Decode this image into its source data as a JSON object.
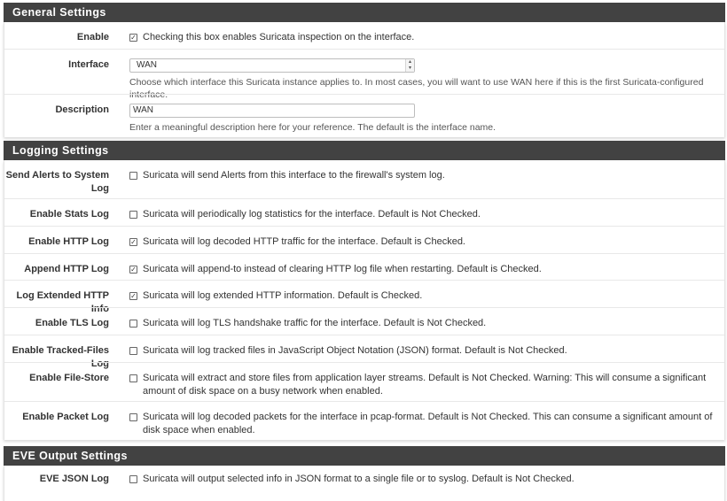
{
  "general": {
    "heading": "General Settings",
    "enable": {
      "label": "Enable",
      "checked": true,
      "text": "Checking this box enables Suricata inspection on the interface."
    },
    "interface": {
      "label": "Interface",
      "value": "WAN",
      "help": "Choose which interface this Suricata instance applies to. In most cases, you will want to use WAN here if this is the first Suricata-configured interface."
    },
    "description": {
      "label": "Description",
      "value": "WAN",
      "help": "Enter a meaningful description here for your reference. The default is the interface name."
    }
  },
  "logging": {
    "heading": "Logging Settings",
    "rows": [
      {
        "label": "Send Alerts to System Log",
        "checked": false,
        "text": "Suricata will send Alerts from this interface to the firewall's system log."
      },
      {
        "label": "Enable Stats Log",
        "checked": false,
        "text": "Suricata will periodically log statistics for the interface. Default is Not Checked."
      },
      {
        "label": "Enable HTTP Log",
        "checked": true,
        "text": "Suricata will log decoded HTTP traffic for the interface. Default is Checked."
      },
      {
        "label": "Append HTTP Log",
        "checked": true,
        "text": "Suricata will append-to instead of clearing HTTP log file when restarting. Default is Checked."
      },
      {
        "label": "Log Extended HTTP Info",
        "checked": true,
        "text": "Suricata will log extended HTTP information. Default is Checked."
      },
      {
        "label": "Enable TLS Log",
        "checked": false,
        "text": "Suricata will log TLS handshake traffic for the interface. Default is Not Checked."
      },
      {
        "label": "Enable Tracked-Files Log",
        "checked": false,
        "text": "Suricata will log tracked files in JavaScript Object Notation (JSON) format. Default is Not Checked."
      },
      {
        "label": "Enable File-Store",
        "checked": false,
        "text": "Suricata will extract and store files from application layer streams. Default is Not Checked. Warning: This will consume a significant amount of disk space on a busy network when enabled."
      },
      {
        "label": "Enable Packet Log",
        "checked": false,
        "text": "Suricata will log decoded packets for the interface in pcap-format. Default is Not Checked. This can consume a significant amount of disk space when enabled."
      }
    ]
  },
  "eve": {
    "heading": "EVE Output Settings",
    "rows": [
      {
        "label": "EVE JSON Log",
        "checked": false,
        "text": "Suricata will output selected info in JSON format to a single file or to syslog. Default is Not Checked."
      }
    ]
  },
  "colors": {
    "heading_bg": "#424242",
    "heading_text": "#ffffff"
  }
}
